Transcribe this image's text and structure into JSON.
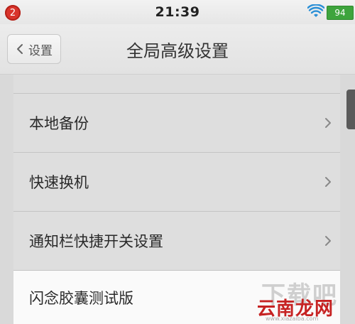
{
  "status_bar": {
    "notification_count": "2",
    "time": "21:39",
    "battery_level": "94",
    "wifi_icon": "wifi-icon",
    "battery_color": "#3ea43d",
    "badge_color": "#d9342b"
  },
  "nav": {
    "back_label": "设置",
    "title": "全局高级设置",
    "back_icon": "chevron-left-icon"
  },
  "list": {
    "items": [
      {
        "label": "本地备份",
        "icon": "chevron-right-icon"
      },
      {
        "label": "快速换机",
        "icon": "chevron-right-icon"
      },
      {
        "label": "通知栏快捷开关设置",
        "icon": "chevron-right-icon"
      },
      {
        "label": "闪念胶囊测试版"
      }
    ]
  },
  "watermark": {
    "line1": "下载吧",
    "line2": "云南龙网",
    "url": "www.xiazaiba.com"
  }
}
